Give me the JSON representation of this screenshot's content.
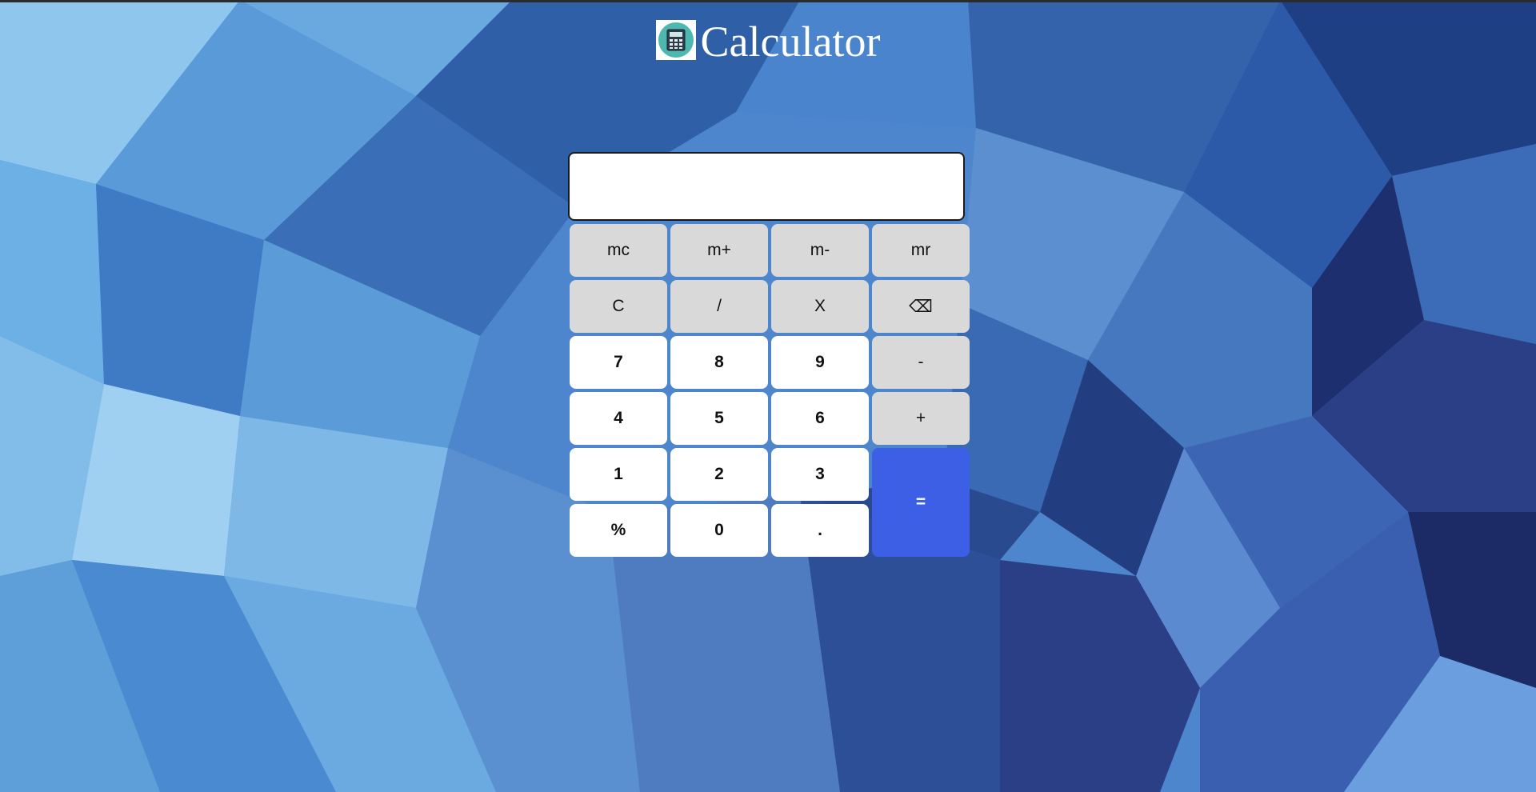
{
  "header": {
    "title": "Calculator",
    "logo_icon": "calculator-icon"
  },
  "display": {
    "value": "",
    "placeholder": ""
  },
  "keys": {
    "mc": "mc",
    "mplus": "m+",
    "mminus": "m-",
    "mr": "mr",
    "clear": "C",
    "divide": "/",
    "multiply": "X",
    "backspace": "⌫",
    "seven": "7",
    "eight": "8",
    "nine": "9",
    "minus": "-",
    "four": "4",
    "five": "5",
    "six": "6",
    "plus": "+",
    "one": "1",
    "two": "2",
    "three": "3",
    "equals": "=",
    "percent": "%",
    "zero": "0",
    "dot": "."
  },
  "colors": {
    "equals": "#3c5fe6",
    "function_key": "#d9d9d9",
    "digit_key": "#ffffff",
    "logo_bg": "#4cb8b0"
  }
}
